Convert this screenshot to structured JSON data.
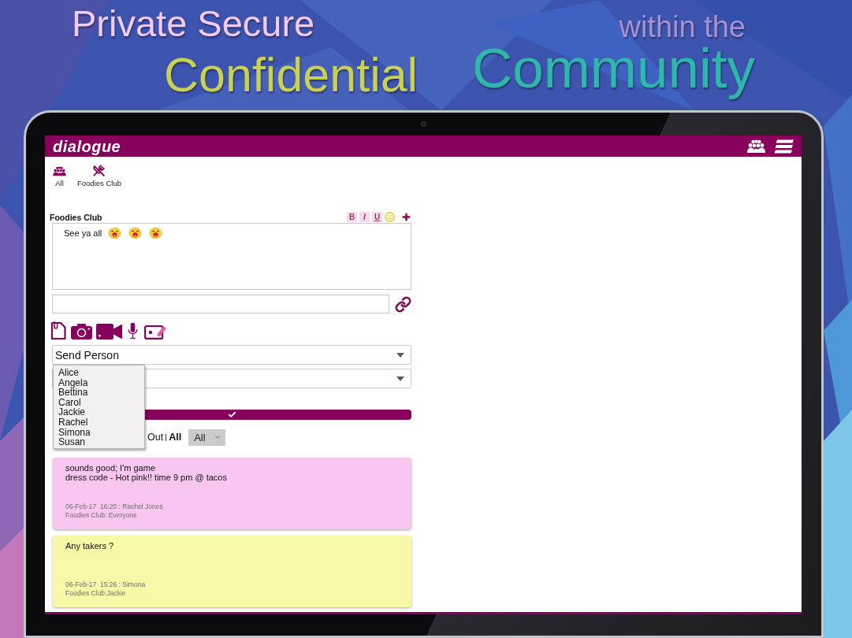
{
  "headline": {
    "line_1": "Private Secure",
    "line_2": "Confidential",
    "line_3": "within the",
    "line_4": "Community"
  },
  "app": {
    "logo": "dialogue",
    "groups": [
      {
        "label": "All",
        "kind": "everyone"
      },
      {
        "label": "Foodies Club",
        "kind": "food"
      }
    ],
    "composer": {
      "title": "Foodies Club",
      "format_buttons": [
        {
          "label": "B",
          "kind": "bold",
          "disabled": true
        },
        {
          "label": "I",
          "kind": "italic",
          "disabled": true
        },
        {
          "label": "U",
          "kind": "underline",
          "disabled": true
        }
      ],
      "draft": "See ya all",
      "recipient_select": {
        "value": "Send Person",
        "expanded": true,
        "options": [
          "Alice",
          "Angela",
          "Bettina",
          "Carol",
          "Jackie",
          "Rachel",
          "Simona",
          "Susan"
        ]
      }
    },
    "filter": {
      "options": [
        {
          "label": "Out",
          "selected": false
        },
        {
          "label": "All",
          "selected": true
        }
      ],
      "select_value": "All"
    },
    "messages": [
      {
        "lines": [
          "sounds good; I'm game",
          "dress code - Hot pink!! time 9 pm @ tacos"
        ],
        "meta": "06-Feb-17  16:20 : Rachel Jones",
        "audience": "Foodies Club: Everyone",
        "color": "#f9c6ef"
      },
      {
        "lines": [
          "Any takers ?"
        ],
        "meta": "06-Feb-17  15:26 : Simona",
        "audience": "Foodies Club:Jackie",
        "color": "#f7f9a8"
      }
    ]
  }
}
